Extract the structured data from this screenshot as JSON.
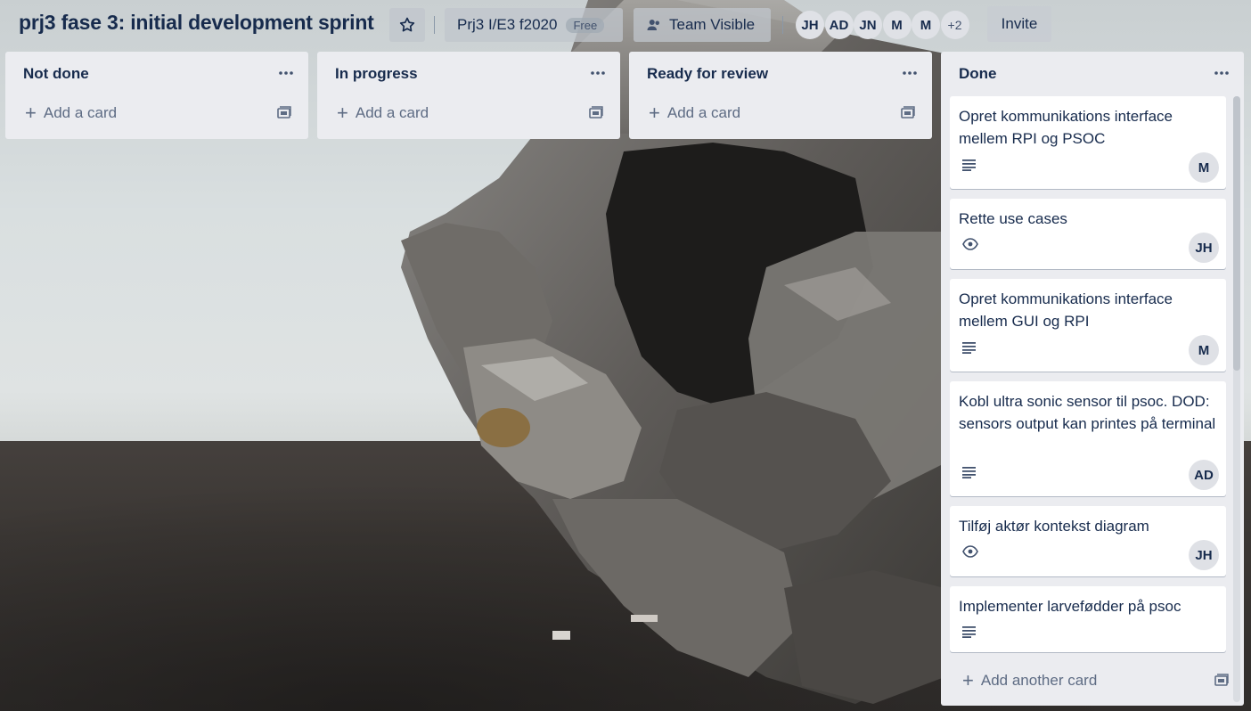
{
  "header": {
    "board_title": "prj3 fase 3: initial development sprint",
    "team_name": "Prj3 I/E3 f2020",
    "team_plan_badge": "Free",
    "visibility_label": "Team Visible",
    "members": [
      "JH",
      "AD",
      "JN",
      "M",
      "M"
    ],
    "members_more": "+2",
    "invite_label": "Invite"
  },
  "lists": [
    {
      "title": "Not done",
      "add_card": "Add a card"
    },
    {
      "title": "In progress",
      "add_card": "Add a card"
    },
    {
      "title": "Ready for review",
      "add_card": "Add a card"
    },
    {
      "title": "Done",
      "add_card": "Add another card",
      "cards": [
        {
          "title": "Opret kommunikations interface mellem RPI og PSOC",
          "badge": "description-icon",
          "member": "M"
        },
        {
          "title": "Rette use cases",
          "badge": "watch-eye-icon",
          "member": "JH"
        },
        {
          "title": "Opret kommunikations interface mellem GUI og RPI",
          "badge": "description-icon",
          "member": "M"
        },
        {
          "title": "Kobl ultra sonic sensor til psoc. DOD: sensors output kan printes på terminal",
          "badge": "description-icon",
          "member": "AD"
        },
        {
          "title": "Tilføj aktør kontekst diagram",
          "badge": "watch-eye-icon",
          "member": "JH"
        },
        {
          "title": "Implementer larvefødder på psoc",
          "badge": "description-icon",
          "member": ""
        }
      ]
    }
  ],
  "colors": {
    "list_bg": "#ebecf0",
    "title_text": "#172b4d",
    "muted_text": "#5e6c84",
    "avatar_bg": "#dfe1e6"
  }
}
